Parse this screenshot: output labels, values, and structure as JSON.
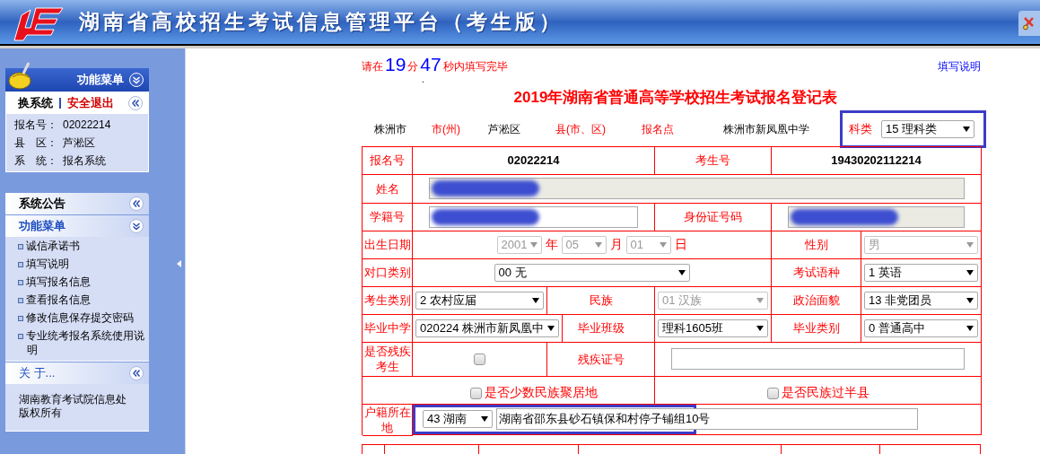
{
  "header": {
    "title": "湖南省高校招生考试信息管理平台（考生版）"
  },
  "sidebar": {
    "account": {
      "title": "功能菜单",
      "switch_label": "换系统",
      "logout_label": "安全退出",
      "fields": [
        {
          "label": "报名号：",
          "value": "02022214"
        },
        {
          "label": "县　区：",
          "value": "芦淞区"
        },
        {
          "label": "系　统：",
          "value": "报名系统"
        }
      ]
    },
    "notice": {
      "title": "系统公告"
    },
    "menu": {
      "title": "功能菜单",
      "items": [
        "诚信承诺书",
        "填写说明",
        "填写报名信息",
        "查看报名信息",
        "修改信息保存提交密码",
        "专业统考报名系统使用说明"
      ]
    },
    "about": {
      "title": "关 于...",
      "text": "湖南教育考试院信息处版权所有"
    }
  },
  "main": {
    "timer": {
      "prefix": "请在",
      "minutes": "19",
      "minutes_unit": "分",
      "seconds": "47",
      "suffix": "秒内填写完毕"
    },
    "help_link": "填写说明",
    "dot": ".",
    "form": {
      "title": "2019年湖南省普通高等学校招生考试报名登记表",
      "location": {
        "city": "株洲市",
        "city_label": "市(州)",
        "county": "芦淞区",
        "county_label": "县(市、区)",
        "site_label": "报名点",
        "site": "株洲市新凤凰中学",
        "category_label": "科类",
        "category": {
          "value": "15 理科类",
          "disabled": false
        },
        "highlighted": true
      },
      "rows": [
        [
          {
            "kind": "label",
            "text": "报名号"
          },
          {
            "kind": "text",
            "text": "02022214"
          },
          {
            "kind": "label",
            "text": "考生号"
          },
          {
            "kind": "text",
            "text": "19430202112214"
          }
        ],
        [
          {
            "kind": "label",
            "text": "姓名"
          },
          {
            "kind": "input",
            "readonly": true,
            "redacted": true
          }
        ],
        [
          {
            "kind": "label",
            "text": "学籍号"
          },
          {
            "kind": "input",
            "readonly": false,
            "redacted": true
          },
          {
            "kind": "label",
            "text": "身份证号码"
          },
          {
            "kind": "input",
            "readonly": true,
            "redacted": true
          }
        ],
        [
          {
            "kind": "label",
            "text": "出生日期"
          },
          {
            "kind": "date",
            "year": {
              "value": "2001",
              "disabled": true
            },
            "year_unit": "年",
            "month": {
              "value": "05",
              "disabled": true
            },
            "month_unit": "月",
            "day": {
              "value": "01",
              "disabled": true
            },
            "day_unit": "日"
          },
          {
            "kind": "label",
            "text": "性别"
          },
          {
            "kind": "select",
            "value": "男",
            "disabled": true
          }
        ],
        [
          {
            "kind": "label",
            "text": "对口类别"
          },
          {
            "kind": "select",
            "value": "00 无",
            "disabled": false
          },
          {
            "kind": "label",
            "text": "考试语种"
          },
          {
            "kind": "select",
            "value": "1 英语",
            "disabled": false
          }
        ],
        [
          {
            "kind": "label",
            "text": "考生类别"
          },
          {
            "kind": "select",
            "value": "2 农村应届",
            "disabled": false
          },
          {
            "kind": "label",
            "text": "民族"
          },
          {
            "kind": "select",
            "value": "01 汉族",
            "disabled": true
          },
          {
            "kind": "label",
            "text": "政治面貌"
          },
          {
            "kind": "select",
            "value": "13 非党团员",
            "disabled": false
          }
        ],
        [
          {
            "kind": "label",
            "text": "毕业中学"
          },
          {
            "kind": "select",
            "value": "020224 株洲市新凤凰中",
            "disabled": false
          },
          {
            "kind": "label",
            "text": "毕业班级"
          },
          {
            "kind": "select",
            "value": "理科1605班",
            "disabled": false
          },
          {
            "kind": "label",
            "text": "毕业类别"
          },
          {
            "kind": "select",
            "value": "0 普通高中",
            "disabled": false
          }
        ],
        [
          {
            "kind": "label",
            "text": "是否残疾考生"
          },
          {
            "kind": "checkbox",
            "checked": false
          },
          {
            "kind": "label",
            "text": "残疾证号"
          },
          {
            "kind": "input",
            "readonly": false,
            "redacted": false
          }
        ],
        [
          {
            "kind": "empty"
          },
          {
            "kind": "checkbox",
            "checked": false,
            "text": "是否少数民族聚居地"
          },
          {
            "kind": "checkbox",
            "checked": false,
            "text": "是否民族过半县"
          }
        ],
        [
          {
            "kind": "label",
            "text": "户籍所在地"
          },
          {
            "kind": "address",
            "select": {
              "value": "43 湖南",
              "disabled": false
            },
            "value": "湖南省邵东县砂石镇保和村停子铺组10号",
            "highlighted": true
          }
        ]
      ]
    }
  }
}
